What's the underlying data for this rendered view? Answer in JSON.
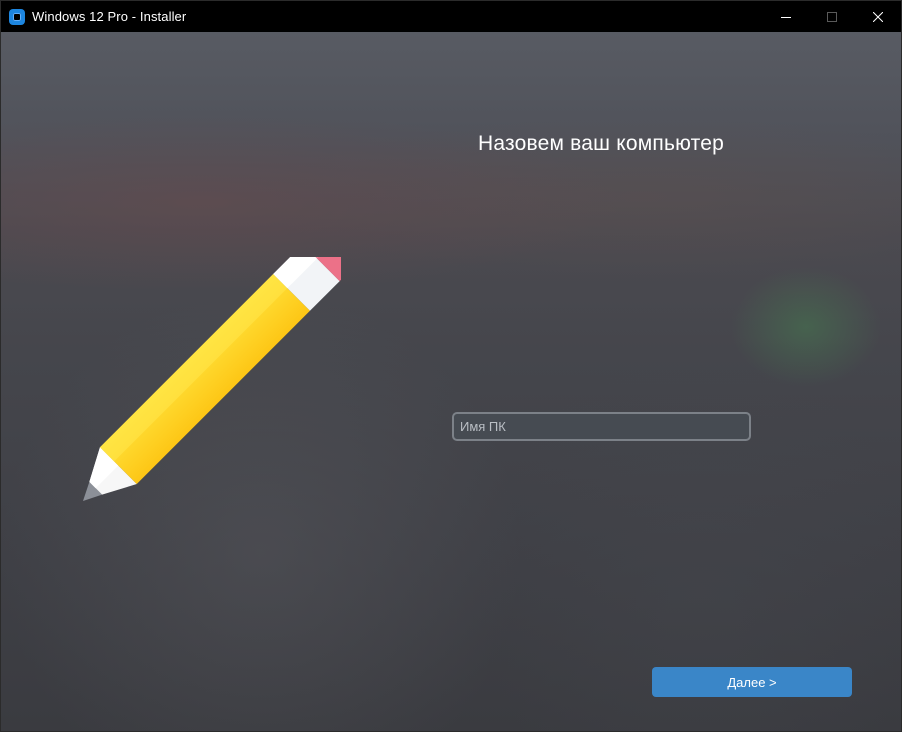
{
  "window": {
    "title": "Windows 12 Pro - Installer",
    "controls": {
      "minimize": "minimize-icon",
      "maximize": "maximize-icon",
      "close": "close-icon"
    }
  },
  "main": {
    "heading": "Назовем ваш компьютер",
    "pc_name": {
      "placeholder": "Имя ПК",
      "value": ""
    },
    "next_button": "Далее >"
  },
  "colors": {
    "accent": "#3a86c8",
    "app_icon": "#1d86e0",
    "pencil_body": "#ffd21f",
    "pencil_eraser": "#e96f86"
  },
  "icons": {
    "app": "app-icon",
    "illustration": "pencil-icon"
  }
}
